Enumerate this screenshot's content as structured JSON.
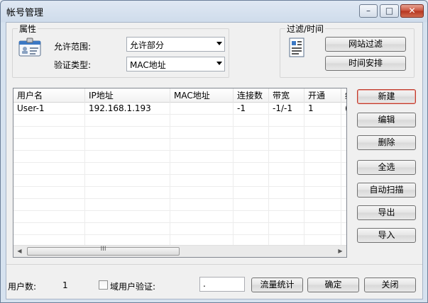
{
  "window": {
    "title": "帐号管理",
    "minimize_glyph": "–",
    "maximize_glyph": "□",
    "close_glyph": "✕"
  },
  "properties": {
    "group_label": "属性",
    "icon": "id-card-icon",
    "scope_label": "允许范围:",
    "scope_value": "允许部分",
    "auth_label": "验证类型:",
    "auth_value": "MAC地址"
  },
  "filter": {
    "group_label": "过滤/时间",
    "icon": "document-list-icon",
    "web_filter_label": "网站过滤",
    "schedule_label": "时间安排"
  },
  "table": {
    "columns": [
      "用户名",
      "IP地址",
      "MAC地址",
      "连接数",
      "带宽",
      "开通",
      "结"
    ],
    "rows": [
      [
        "User-1",
        "192.168.1.193",
        "",
        "-1",
        "-1/-1",
        "1",
        "("
      ]
    ],
    "scroll_grip": "III",
    "scroll_left": "◀",
    "scroll_right": "▶"
  },
  "actions": {
    "new_label": "新建",
    "edit_label": "编辑",
    "delete_label": "删除",
    "select_all_label": "全选",
    "auto_scan_label": "自动扫描",
    "export_label": "导出",
    "import_label": "导入"
  },
  "footer": {
    "user_count_label": "用户数:",
    "user_count_value": "1",
    "domain_auth_label": "域用户验证:",
    "domain_auth_checked": false,
    "domain_input_value": ".",
    "traffic_stats_label": "流量统计",
    "ok_label": "确定",
    "close_label": "关闭"
  },
  "colors": {
    "default_button_border": "#c0392b",
    "close_button": "#c9513b"
  }
}
